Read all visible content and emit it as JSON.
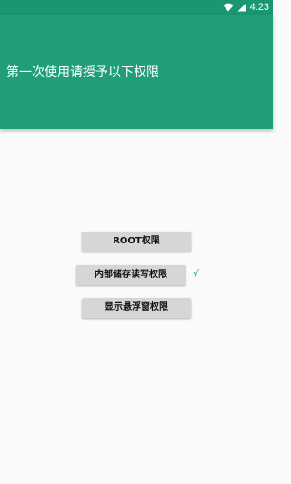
{
  "status_bar": {
    "time": "4:23",
    "icons": [
      "wifi-icon",
      "signal-icon"
    ],
    "color": "#1a9771"
  },
  "header": {
    "title": "第一次使用请授予以下权限",
    "color": "#1f9e77"
  },
  "permissions": [
    {
      "label": "ROOT权限",
      "granted": false
    },
    {
      "label": "内部储存读写权限",
      "granted": true,
      "check": "√"
    },
    {
      "label": "显示悬浮窗权限",
      "granted": false
    }
  ]
}
